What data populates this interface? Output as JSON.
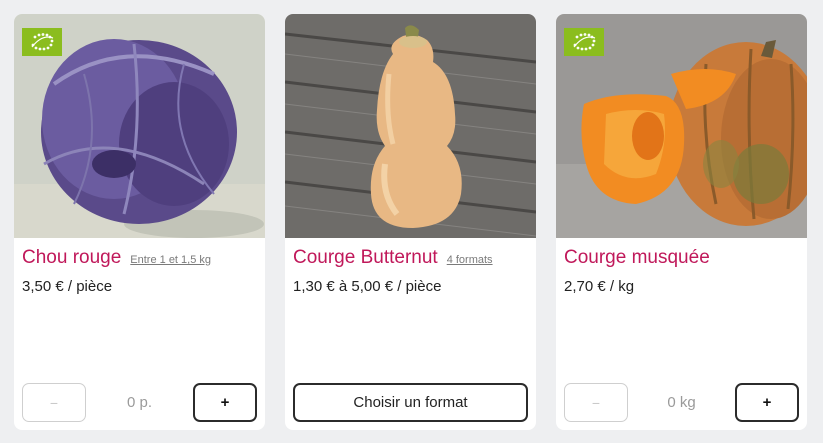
{
  "products": [
    {
      "name": "Chou rouge",
      "subtitle": "Entre 1 et 1,5 kg",
      "price": "3,50 € / pièce",
      "organic": true,
      "image": "red-cabbage-photo",
      "minus_label": "−",
      "quantity": "0 p.",
      "plus_label": "+"
    },
    {
      "name": "Courge Butternut",
      "subtitle": "4 formats",
      "price": "1,30 € à 5,00 € / pièce",
      "organic": false,
      "image": "butternut-squash-photo",
      "choose_format_label": "Choisir un format"
    },
    {
      "name": "Courge musquée",
      "price": "2,70 € / kg",
      "organic": true,
      "image": "musk-pumpkin-photo",
      "minus_label": "−",
      "quantity": "0 kg",
      "plus_label": "+"
    }
  ],
  "colors": {
    "title": "#c0185a",
    "organic_badge": "#8bbd1e",
    "background": "#eeeff1"
  }
}
